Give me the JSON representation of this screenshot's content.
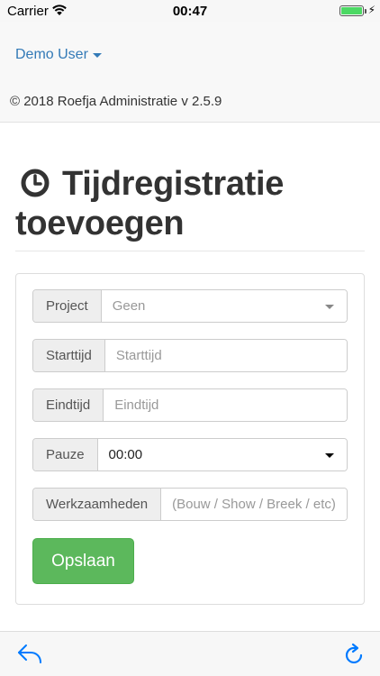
{
  "status_bar": {
    "carrier": "Carrier",
    "time": "00:47",
    "battery_level": 1.0,
    "battery_color": "#4cd964"
  },
  "nav": {
    "user": "Demo User",
    "copyright": "© 2018 Roefja Administratie v 2.5.9"
  },
  "page": {
    "title": "Tijdregistratie toevoegen",
    "title_icon": "clock-icon"
  },
  "form": {
    "project": {
      "label": "Project",
      "value": "Geen"
    },
    "starttijd": {
      "label": "Starttijd",
      "placeholder": "Starttijd"
    },
    "eindtijd": {
      "label": "Eindtijd",
      "placeholder": "Eindtijd"
    },
    "pauze": {
      "label": "Pauze",
      "value": "00:00"
    },
    "werkzaamheden": {
      "label": "Werkzaamheden",
      "placeholder": "(Bouw / Show / Breek / etc)"
    },
    "save_label": "Opslaan"
  },
  "toolbar": {
    "back_icon": "back-arrow-icon",
    "refresh_icon": "refresh-icon"
  },
  "colors": {
    "link": "#337ab7",
    "success": "#5cb85c",
    "ios_blue": "#007aff"
  }
}
